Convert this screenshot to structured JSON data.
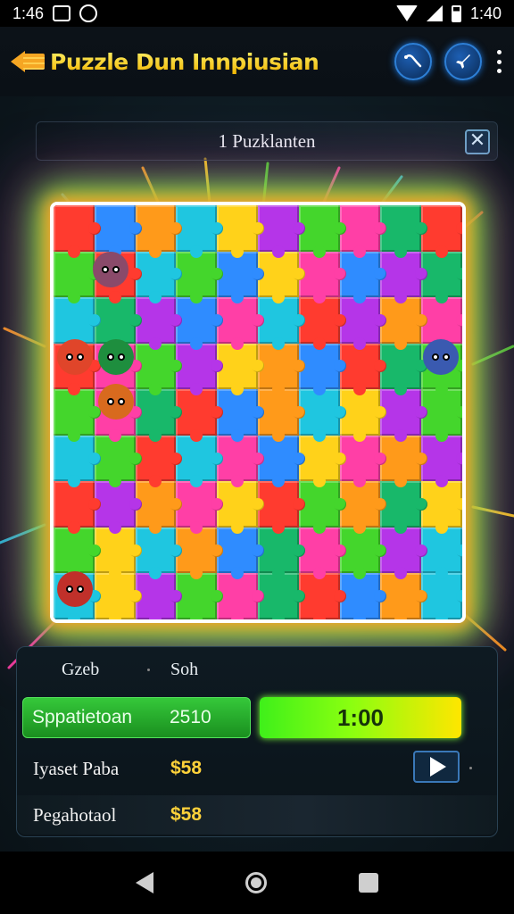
{
  "status_bar": {
    "time_left": "1:46",
    "time_right": "1:40"
  },
  "app_bar": {
    "title": "Puzzle Dun Innpiusian",
    "icons": [
      "back-arrow-icon",
      "swirl-icon",
      "rocket-icon",
      "more-vert-icon"
    ]
  },
  "level_banner": {
    "text": "1 Puzklanten",
    "close_label": "✕"
  },
  "board": {
    "rows": 9,
    "cols": 10,
    "palette": [
      "#ff3b2f",
      "#ff9a1a",
      "#ffd21a",
      "#44d62c",
      "#18b86a",
      "#2f8cff",
      "#1fc6e0",
      "#b535e8",
      "#ff3fa6"
    ]
  },
  "score_panel": {
    "header_col1": "Gzeb",
    "header_col2": "Soh",
    "progress_label": "Sppatietoan",
    "progress_value": "2510",
    "timer": "1:00",
    "row1_label": "Iyaset Paba",
    "row1_value": "$58",
    "row2_label": "Pegahotaol",
    "row2_value": "$58"
  },
  "colors": {
    "title_gold": "#f5c400",
    "accent_green": "#35c83a",
    "timer_yellow": "#ffe600",
    "money_gold": "#ffd23a"
  }
}
